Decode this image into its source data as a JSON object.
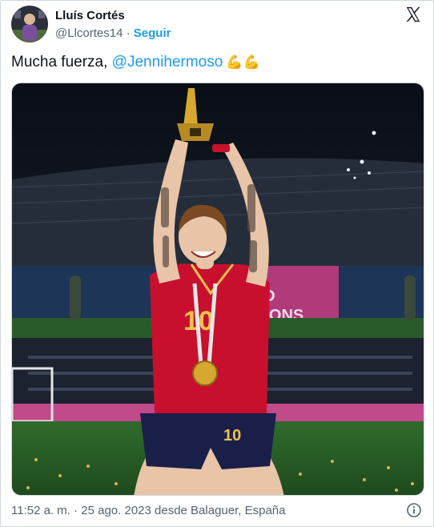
{
  "author": {
    "name": "Lluís Cortés",
    "handle": "@Llcortes14",
    "separator": "·",
    "follow_label": "Seguir"
  },
  "tweet": {
    "text": "Mucha fuerza, ",
    "mention": "@Jennihermoso",
    "emojis": "💪💪"
  },
  "media": {
    "banner_text_1": "LD",
    "banner_text_2": "PIONS",
    "shirt_number": "10",
    "shorts_number": "10"
  },
  "footer": {
    "timestamp": "11:52 a. m. · 25 ago. 2023 desde Balaguer, España"
  },
  "colors": {
    "accent": "#1d9bf0",
    "text": "#0f1419",
    "muted": "#536471",
    "jersey": "#c8102e",
    "banner": "#b03a7a"
  },
  "icons": [
    "x-logo-icon",
    "info-icon"
  ]
}
